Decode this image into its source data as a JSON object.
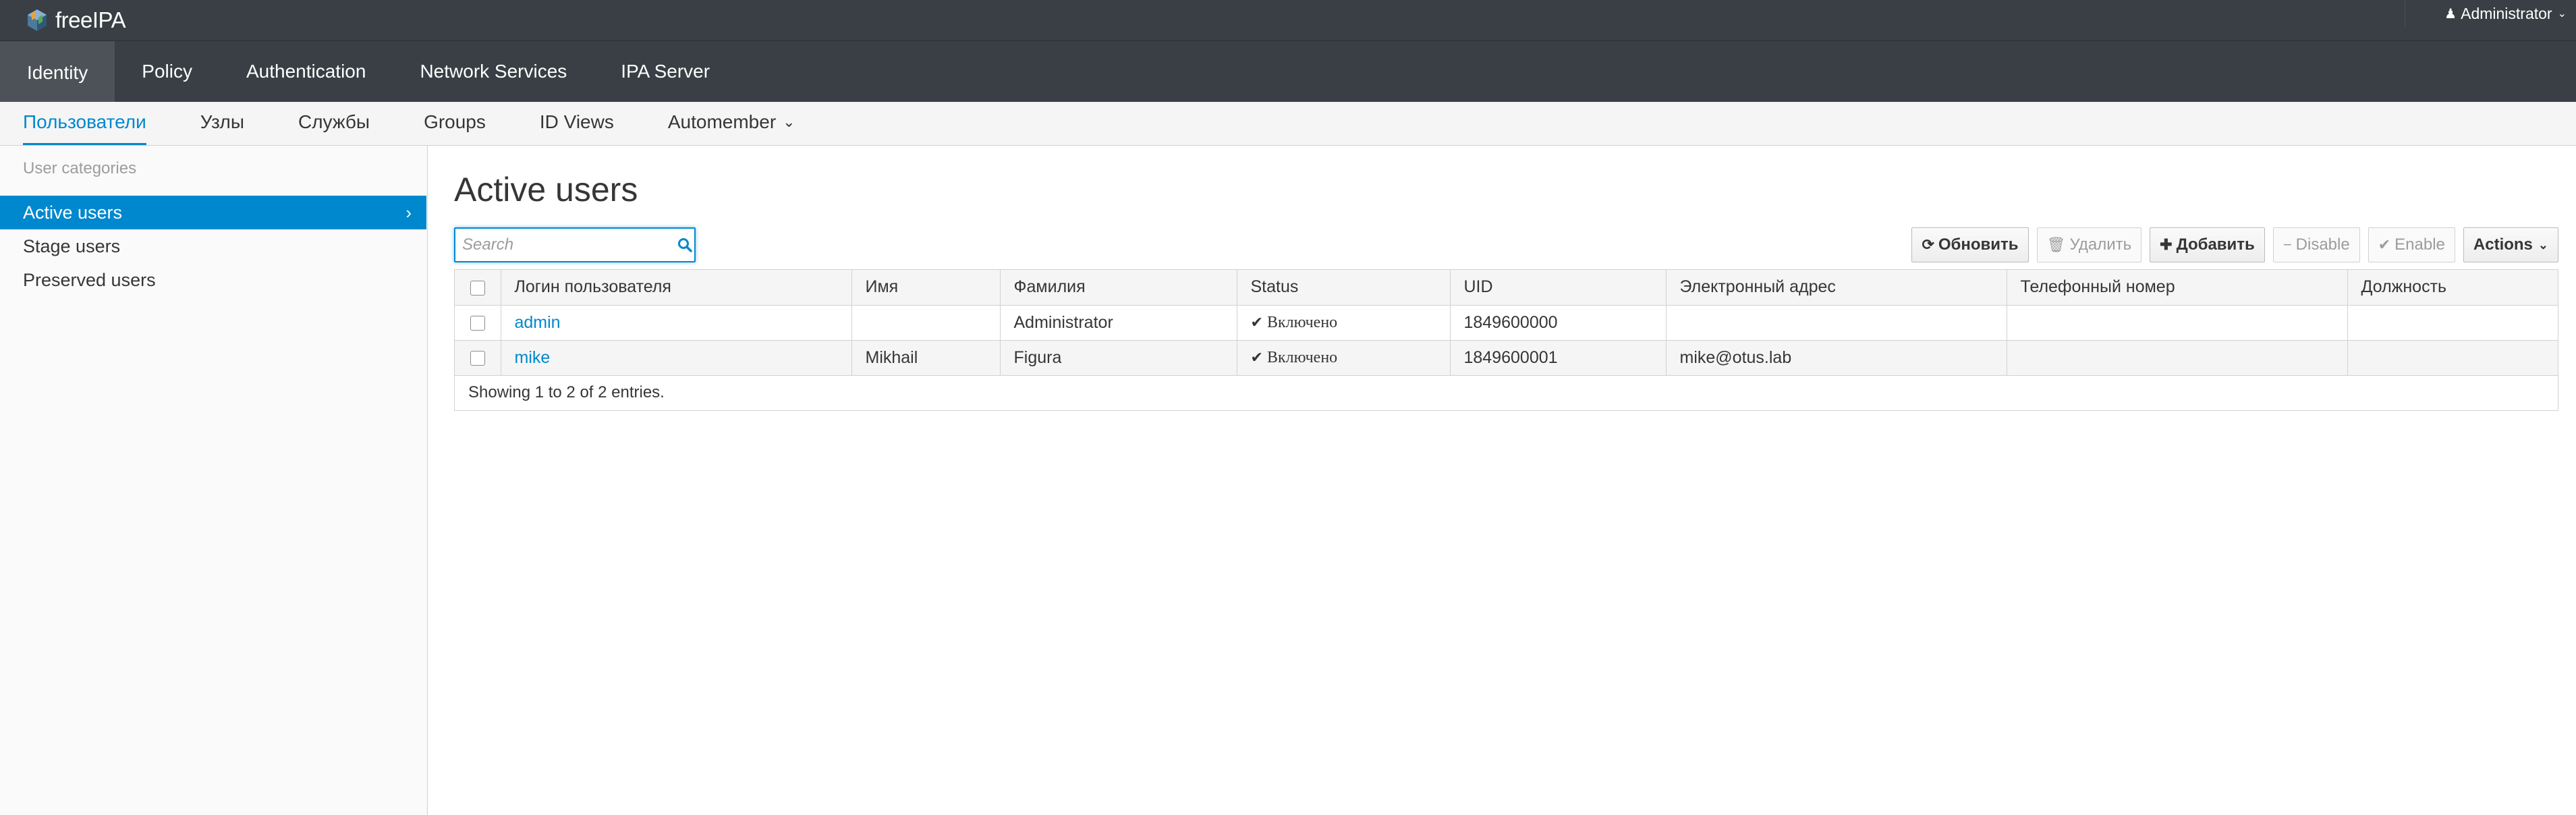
{
  "app": {
    "brand": "freeIPA",
    "user_menu": "Administrator"
  },
  "primary_nav": [
    {
      "label": "Identity",
      "active": true
    },
    {
      "label": "Policy"
    },
    {
      "label": "Authentication"
    },
    {
      "label": "Network Services"
    },
    {
      "label": "IPA Server"
    }
  ],
  "secondary_nav": [
    {
      "label": "Пользователи",
      "active": true
    },
    {
      "label": "Узлы"
    },
    {
      "label": "Службы"
    },
    {
      "label": "Groups"
    },
    {
      "label": "ID Views"
    },
    {
      "label": "Automember"
    }
  ],
  "sidebar": {
    "heading": "User categories",
    "items": [
      {
        "label": "Active users",
        "active": true
      },
      {
        "label": "Stage users"
      },
      {
        "label": "Preserved users"
      }
    ]
  },
  "main": {
    "title": "Active users",
    "search_placeholder": "Search",
    "toolbar": {
      "refresh": "Обновить",
      "delete": "Удалить",
      "add": "Добавить",
      "disable": "Disable",
      "enable": "Enable",
      "actions": "Actions"
    },
    "table": {
      "columns": [
        "Логин пользователя",
        "Имя",
        "Фамилия",
        "Status",
        "UID",
        "Электронный адрес",
        "Телефонный номер",
        "Должность"
      ],
      "rows": [
        {
          "login": "admin",
          "first": "",
          "last": "Administrator",
          "status": "Включено",
          "uid": "1849600000",
          "email": "",
          "phone": "",
          "title": ""
        },
        {
          "login": "mike",
          "first": "Mikhail",
          "last": "Figura",
          "status": "Включено",
          "uid": "1849600001",
          "email": "mike@otus.lab",
          "phone": "",
          "title": ""
        }
      ],
      "footer": "Showing 1 to 2 of 2 entries."
    }
  },
  "icons": {
    "user": "user-icon",
    "search": "search-icon",
    "refresh": "refresh-icon",
    "trash": "trash-icon",
    "plus": "plus-icon",
    "minus": "minus-icon",
    "check": "check-icon"
  },
  "colors": {
    "accent": "#0088ce",
    "nav_bg": "#393f44",
    "nav_active": "#4d5258"
  }
}
